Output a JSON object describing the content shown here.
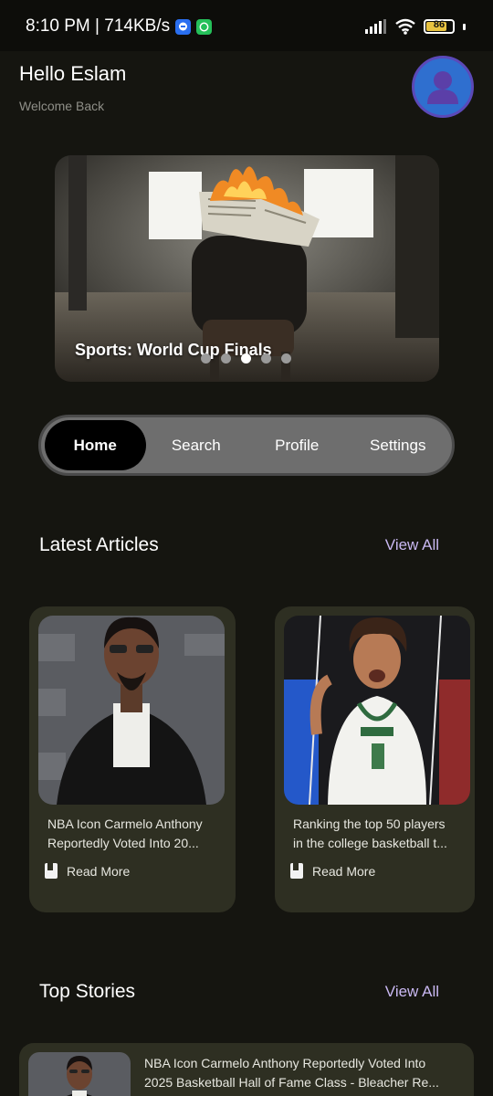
{
  "status_bar": {
    "time_speed": "8:10 PM | 714KB/s",
    "battery": "86"
  },
  "header": {
    "title": "Hello Eslam",
    "subtitle": "Welcome Back"
  },
  "carousel": {
    "caption": "Sports: World Cup Finals",
    "dot_count": 5,
    "active_dot": 2
  },
  "tabs": [
    {
      "label": "Home",
      "active": true
    },
    {
      "label": "Search",
      "active": false
    },
    {
      "label": "Profile",
      "active": false
    },
    {
      "label": "Settings",
      "active": false
    }
  ],
  "latest": {
    "title": "Latest Articles",
    "view_all": "View All",
    "articles": [
      {
        "line1": "NBA Icon Carmelo Anthony",
        "line2": "Reportedly Voted Into 20...",
        "read_more": "Read More"
      },
      {
        "line1": "Ranking the top 50 players",
        "line2": "in the college basketball t...",
        "read_more": "Read More"
      }
    ]
  },
  "top_stories": {
    "title": "Top Stories",
    "view_all": "View All",
    "items": [
      {
        "line1": "NBA Icon Carmelo Anthony Reportedly Voted Into",
        "line2": "2025 Basketball Hall of Fame Class - Bleacher Re..."
      }
    ]
  },
  "colors": {
    "background": "#151510",
    "card": "#2e2f22",
    "accent": "#c9b8f2",
    "tab_bar": "#6e6e6e"
  }
}
